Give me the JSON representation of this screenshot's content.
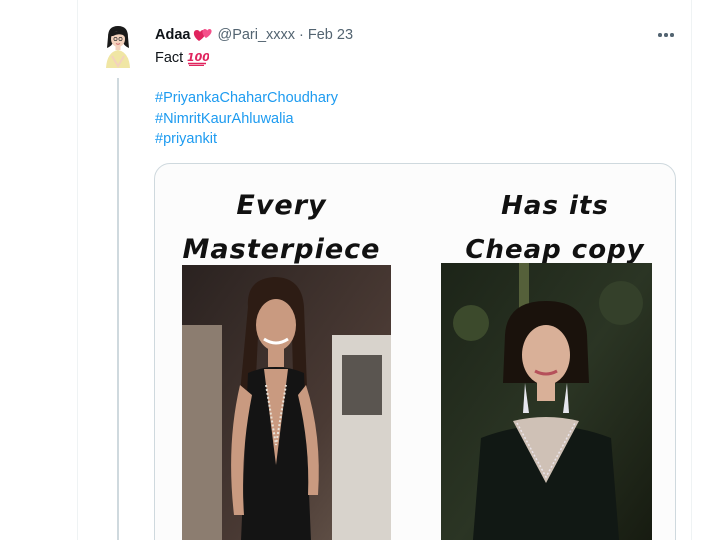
{
  "tweet": {
    "display_name": "Adaa",
    "name_emoji": "hearts-emoji",
    "handle": "@Pari_xxxx",
    "separator": "·",
    "time": "Feb 23",
    "text": "Fact",
    "text_emoji": "hundred-points-emoji",
    "hashtags": [
      "#PriyankaChaharChoudhary",
      "#NimritKaurAhluwalia",
      "#priyankit"
    ],
    "more_icon": "more-horizontal-icon"
  },
  "media": {
    "left_caption_line1": "Every",
    "left_caption_line2": "Masterpiece",
    "right_caption_line1": "Has its",
    "right_caption_line2": "Cheap copy"
  },
  "colors": {
    "link": "#1d9bf0",
    "secondary_text": "#536471",
    "border": "#cfd9de"
  }
}
